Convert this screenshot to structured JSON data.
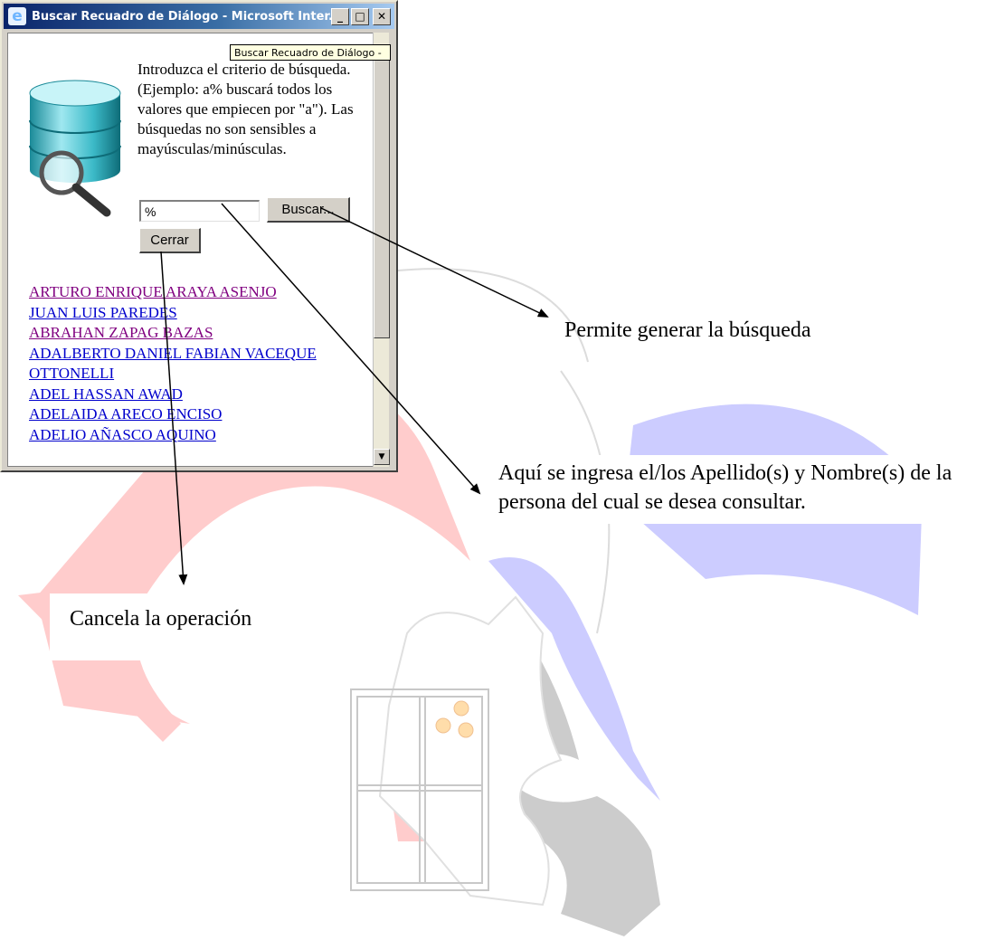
{
  "window": {
    "title": "Buscar Recuadro de Diálogo - Microsoft Inter...",
    "minimize_label": "_",
    "maximize_label": "□",
    "close_label": "✕"
  },
  "tooltip": "Buscar Recuadro de Diálogo - ",
  "instructions": "Introduzca el criterio de búsqueda. (Ejemplo: a% buscará todos los valores que empiecen por \"a\"). Las búsquedas no son sensibles a mayúsculas/minúsculas.",
  "search": {
    "value": "%"
  },
  "buttons": {
    "search": "Buscar...",
    "close": "Cerrar"
  },
  "results": [
    {
      "label": "ARTURO ENRIQUE ARAYA ASENJO",
      "visited": true
    },
    {
      "label": "JUAN LUIS PAREDES",
      "visited": false
    },
    {
      "label": "ABRAHAN ZAPAG BAZAS",
      "visited": true
    },
    {
      "label": "ADALBERTO DANIEL FABIAN VACEQUE",
      "visited": false
    },
    {
      "label": "OTTONELLI",
      "visited": false
    },
    {
      "label": "ADEL HASSAN AWAD",
      "visited": false
    },
    {
      "label": "ADELAIDA ARECO ENCISO",
      "visited": false
    },
    {
      "label": "ADELIO AÑASCO AQUINO",
      "visited": false
    }
  ],
  "annotations": {
    "search_button": "Permite generar la búsqueda",
    "search_input": "Aquí se ingresa el/los  Apellido(s) y Nombre(s) de la persona del cual se desea consultar.",
    "close_button": "Cancela la operación"
  },
  "colors": {
    "visited_link": "#800080",
    "link": "#0000cc",
    "watermark_red": "#ffcccc",
    "watermark_blue": "#ccccff",
    "watermark_gray": "#cccccc"
  },
  "icons": {
    "app": "ie-icon",
    "database": "database-search-icon",
    "scroll_down": "scroll-down-arrow-icon"
  }
}
